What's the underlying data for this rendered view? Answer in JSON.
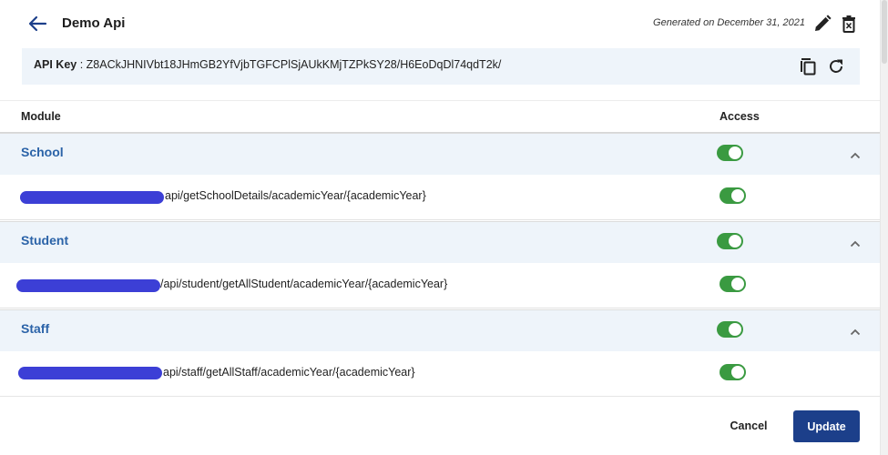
{
  "header": {
    "title": "Demo Api",
    "generated": "Generated on December 31, 2021"
  },
  "api_key": {
    "label": "API Key",
    "separator": " : ",
    "value": "Z8ACkJHNIVbt18JHmGB2YfVjbTGFCPlSjAUkKMjTZPkSY28/H6EoDqDl74qdT2k/"
  },
  "table": {
    "module_header": "Module",
    "access_header": "Access"
  },
  "groups": [
    {
      "name": "School",
      "enabled": true,
      "expanded": true,
      "endpoint": "api/getSchoolDetails/academicYear/{academicYear}",
      "endpoint_enabled": true
    },
    {
      "name": "Student",
      "enabled": true,
      "expanded": true,
      "endpoint": "/api/student/getAllStudent/academicYear/{academicYear}",
      "endpoint_enabled": true
    },
    {
      "name": "Staff",
      "enabled": true,
      "expanded": true,
      "endpoint": "api/staff/getAllStaff/academicYear/{academicYear}",
      "endpoint_enabled": true
    }
  ],
  "footer": {
    "cancel_label": "Cancel",
    "update_label": "Update"
  },
  "colors": {
    "accent": "#1c3f8a",
    "group_title": "#2b63a8",
    "toggle_on": "#3a9a41",
    "panel_bg": "#eef4fa"
  },
  "icons": {
    "back": "arrow-left-icon",
    "edit": "pencil-icon",
    "delete": "trash-icon",
    "copy": "copy-icon",
    "refresh": "refresh-icon",
    "collapse": "chevron-up-icon"
  }
}
